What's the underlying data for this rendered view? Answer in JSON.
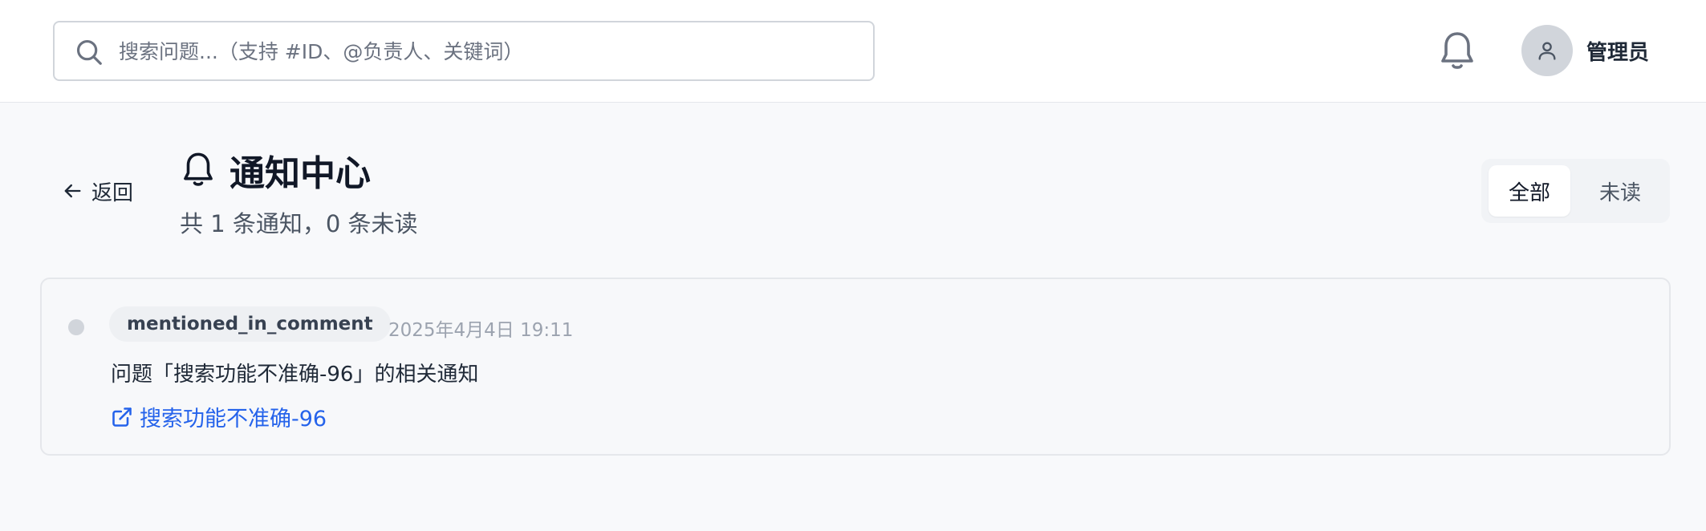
{
  "search": {
    "placeholder": "搜索问题...（支持 #ID、@负责人、关键词）",
    "value": ""
  },
  "header": {
    "user_name": "管理员"
  },
  "nav": {
    "back_label": "返回"
  },
  "page": {
    "title": "通知中心",
    "summary": "共 1 条通知，0 条未读"
  },
  "filter": {
    "options": [
      "全部",
      "未读"
    ],
    "selected": "全部"
  },
  "notifications": [
    {
      "type": "mentioned_in_comment",
      "time": "2025年4月4日 19:11",
      "message": "问题「搜索功能不准确-96」的相关通知",
      "link_text": "搜索功能不准确-96",
      "read": true
    }
  ],
  "icons": {
    "search": "search-icon",
    "bell": "bell-icon",
    "user": "user-icon",
    "back": "arrow-left-icon",
    "external": "external-link-icon"
  },
  "colors": {
    "link": "#2563eb",
    "page_bg": "#f8f9fb",
    "read_dot": "#d1d5db"
  }
}
